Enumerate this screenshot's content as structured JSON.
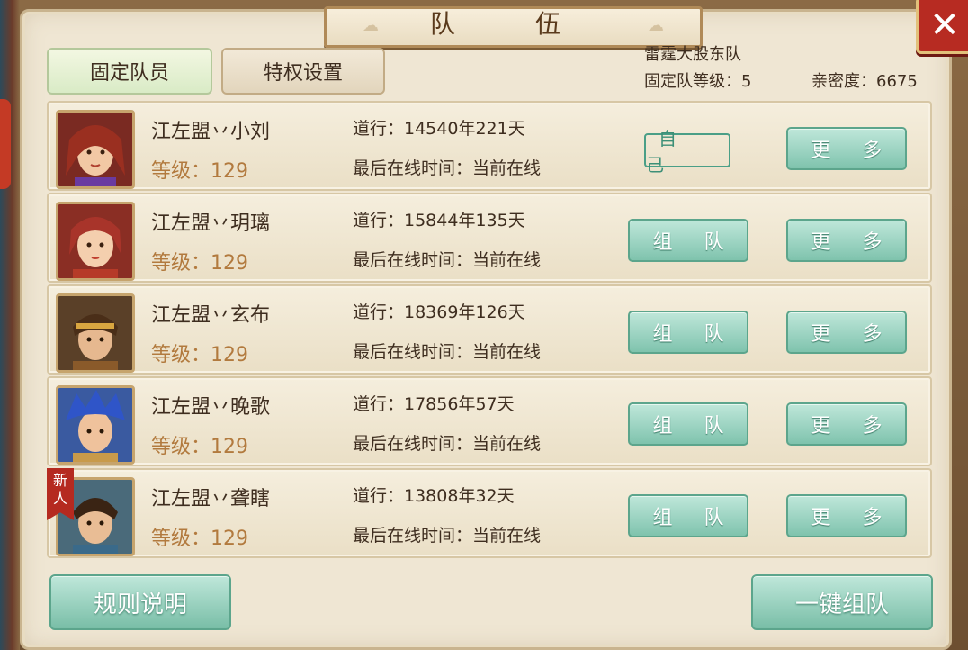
{
  "window": {
    "title": "队 伍",
    "close_icon": "close-icon"
  },
  "tabs": [
    {
      "label": "固定队员",
      "active": true
    },
    {
      "label": "特权设置",
      "active": false
    }
  ],
  "team": {
    "name": "雷霆大股东队",
    "level_text": "固定队等级：5",
    "intimacy_text": "亲密度：6675"
  },
  "members": [
    {
      "name": "江左盟丷小刘",
      "level": "等级：129",
      "daoxing": "道行：14540年221天",
      "online": "最后在线时间：当前在线",
      "is_self": true,
      "self_label": "自 己",
      "more_label": "更 多",
      "new_label": ""
    },
    {
      "name": "江左盟丷玥璃",
      "level": "等级：129",
      "daoxing": "道行：15844年135天",
      "online": "最后在线时间：当前在线",
      "is_self": false,
      "team_label": "组 队",
      "more_label": "更 多",
      "new_label": ""
    },
    {
      "name": "江左盟丷玄布",
      "level": "等级：129",
      "daoxing": "道行：18369年126天",
      "online": "最后在线时间：当前在线",
      "is_self": false,
      "team_label": "组 队",
      "more_label": "更 多",
      "new_label": ""
    },
    {
      "name": "江左盟丷晚歌",
      "level": "等级：129",
      "daoxing": "道行：17856年57天",
      "online": "最后在线时间：当前在线",
      "is_self": false,
      "team_label": "组 队",
      "more_label": "更 多",
      "new_label": ""
    },
    {
      "name": "江左盟丷聋瞎",
      "level": "等级：129",
      "daoxing": "道行：13808年32天",
      "online": "最后在线时间：当前在线",
      "is_self": false,
      "team_label": "组 队",
      "more_label": "更 多",
      "new_label": "新人"
    }
  ],
  "footer": {
    "rules_label": "规则说明",
    "oneclick_label": "一键组队"
  },
  "colors": {
    "accent_green": "#7fc3ad",
    "level_text": "#b27a3e",
    "close_red": "#b72b22",
    "panel_bg": "#efe6d3"
  }
}
